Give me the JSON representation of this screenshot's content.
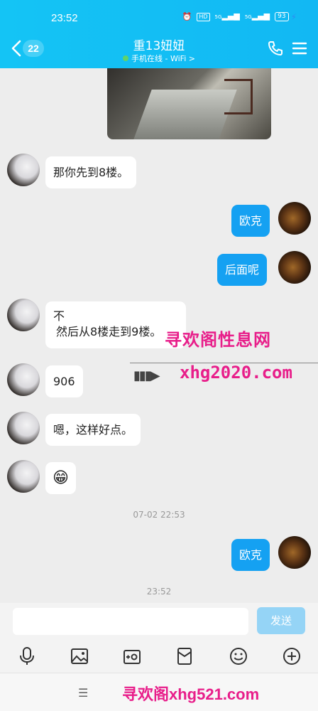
{
  "status": {
    "time": "23:52",
    "hd": "HD",
    "sig1": "5G",
    "sig2": "5G",
    "battery": "93"
  },
  "header": {
    "back_count": "22",
    "title": "重13妞妞",
    "subtitle": "手机在线 - WiFi",
    "subtitle_arrow": ">"
  },
  "messages": [
    {
      "side": "in",
      "text": "那你先到8楼。"
    },
    {
      "side": "out",
      "text": "欧克"
    },
    {
      "side": "out",
      "text": "后面呢"
    },
    {
      "side": "in",
      "line1": "不",
      "line2": "然后从8楼走到9楼。"
    },
    {
      "side": "in",
      "text": "906"
    },
    {
      "side": "in",
      "text": "嗯，这样好点。"
    },
    {
      "side": "in",
      "emoji": "😁"
    },
    {
      "side": "out",
      "text": "欧克"
    }
  ],
  "timestamps": [
    "07-02 22:53",
    "23:52"
  ],
  "watermark": {
    "top": "寻欢阁性息网",
    "arrow": "▮▮▮▶",
    "url": "xhg2020.com",
    "bottom": "寻欢阁xhg521.com"
  },
  "input": {
    "placeholder": "",
    "send_label": "发送"
  },
  "toolbar": [
    "mic-icon",
    "image-icon",
    "camera-icon",
    "red-packet-icon",
    "emoji-icon",
    "plus-icon"
  ],
  "nav": {
    "menu": "☰"
  }
}
